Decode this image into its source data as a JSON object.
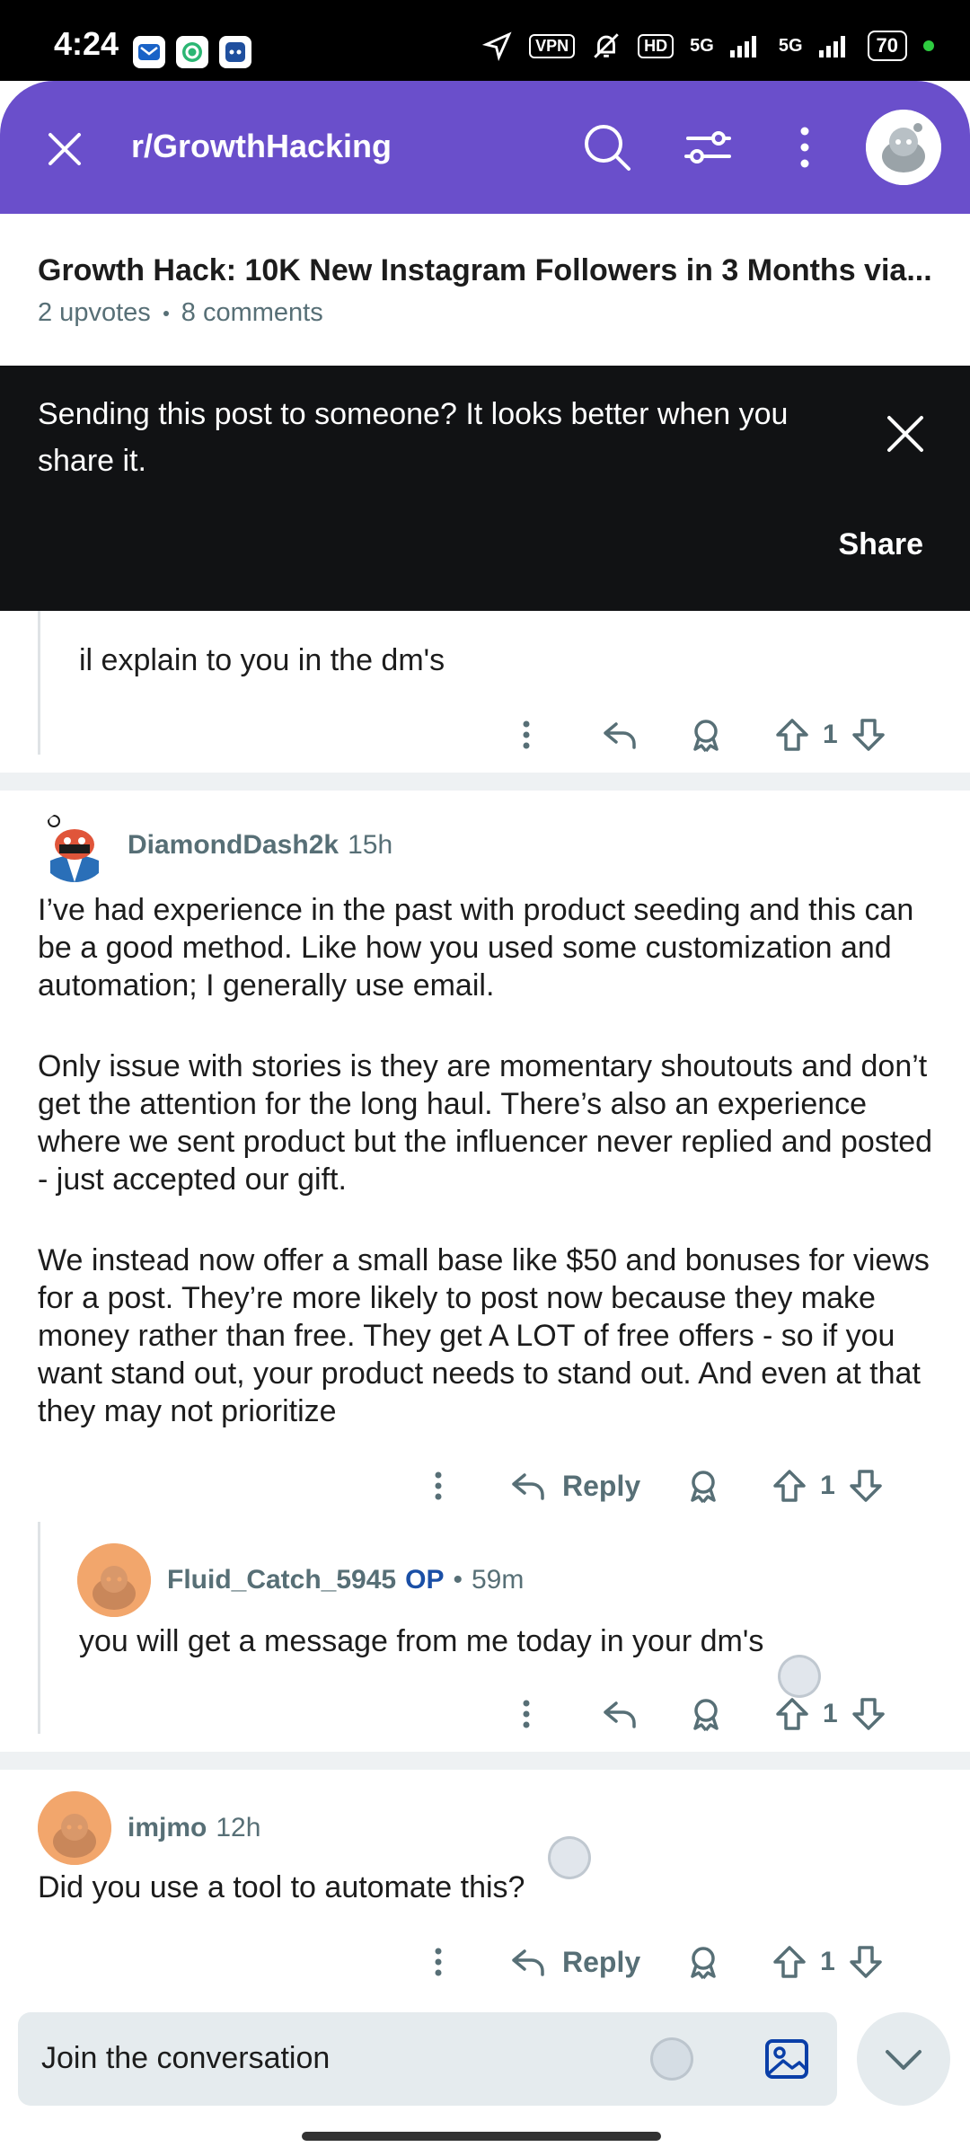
{
  "status_bar": {
    "time": "4:24",
    "vpn": "VPN",
    "hd": "HD",
    "network_1": "5G",
    "network_2": "5G",
    "battery": "70"
  },
  "header": {
    "subreddit": "r/GrowthHacking",
    "icons": [
      "close-icon",
      "search-icon",
      "filter-icon",
      "more-vertical-icon",
      "avatar"
    ]
  },
  "post": {
    "title": "Growth Hack: 10K New Instagram Followers in 3 Months via...",
    "upvotes": "2 upvotes",
    "comments": "8 comments"
  },
  "toast": {
    "message": "Sending this post to someone? It looks better when you share it.",
    "action": "Share"
  },
  "comments": [
    {
      "text": "il explain to you in the dm's",
      "votes": "1"
    },
    {
      "username": "DiamondDash2k",
      "age": "15h",
      "paragraphs": [
        "I’ve had experience in the past with product seeding and this can be a good method. Like how you used some customization and automation; I generally use email.",
        "Only issue with stories is they are momentary shoutouts and don’t get the attention for the long haul. There’s also an experience where we sent product but the influencer never replied and posted - just accepted our gift.",
        "We instead now offer a small base like $50 and bonuses for views for a post. They’re more likely to post now because they make money rather than free. They get A LOT of free offers - so if you want stand out, your product needs to stand out. And even at that they may not prioritize"
      ],
      "reply_label": "Reply",
      "votes": "1"
    },
    {
      "username": "Fluid_Catch_5945",
      "op_badge": "OP",
      "sep": "•",
      "age": "59m",
      "text": "you will get a message from me today in your dm's",
      "votes": "1"
    },
    {
      "username": "imjmo",
      "age": "12h",
      "text": "Did you use a tool to automate this?",
      "reply_label": "Reply",
      "votes": "1"
    }
  ],
  "composer": {
    "placeholder": "Join the conversation"
  }
}
